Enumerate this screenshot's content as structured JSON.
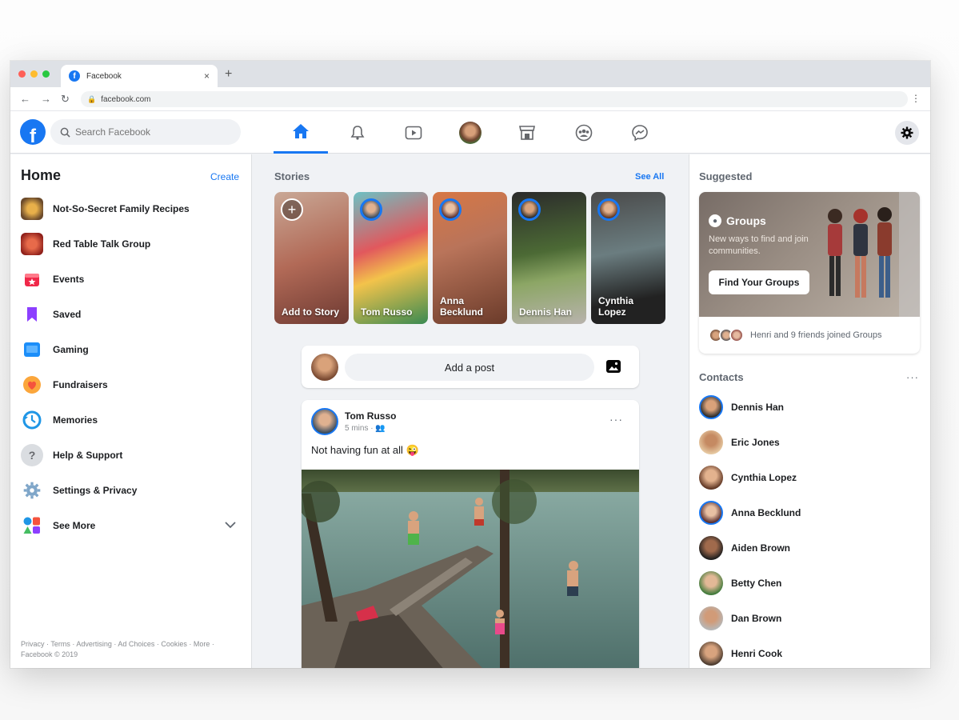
{
  "browser": {
    "tab_title": "Facebook",
    "tab_close": "×",
    "new_tab": "+",
    "url": "facebook.com",
    "back": "←",
    "forward": "→",
    "reload": "↻",
    "menu": "⋮"
  },
  "header": {
    "logo": "f",
    "search_placeholder": "Search Facebook",
    "nav_icons": [
      "home-icon",
      "bell-icon",
      "watch-icon",
      "profile-avatar",
      "marketplace-icon",
      "groups-icon",
      "messenger-icon"
    ],
    "active_tab": "home",
    "brand_color": "#1877f2"
  },
  "left": {
    "title": "Home",
    "create_label": "Create",
    "items": [
      {
        "label": "Not-So-Secret Family Recipes",
        "icon": "recipes-group-icon",
        "color": "#b8742e"
      },
      {
        "label": "Red Table Talk Group",
        "icon": "red-table-group-icon",
        "color": "#c0392b"
      },
      {
        "label": "Events",
        "icon": "events-icon",
        "color": "#f02849"
      },
      {
        "label": "Saved",
        "icon": "saved-icon",
        "color": "#8c3fff"
      },
      {
        "label": "Gaming",
        "icon": "gaming-icon",
        "color": "#1c8ef9"
      },
      {
        "label": "Fundraisers",
        "icon": "fundraisers-icon",
        "color": "#f5533d"
      },
      {
        "label": "Memories",
        "icon": "memories-icon",
        "color": "#1f96e6"
      },
      {
        "label": "Help & Support",
        "icon": "help-icon",
        "color": "#b0b3b8"
      },
      {
        "label": "Settings & Privacy",
        "icon": "settings-icon",
        "color": "#7fa6c9"
      },
      {
        "label": "See More",
        "icon": "see-more-icon",
        "color": "#e74c3c"
      }
    ],
    "footer": "Privacy · Terms · Advertising · Ad Choices · Cookies · More · Facebook © 2019"
  },
  "stories": {
    "title": "Stories",
    "see_all": "See All",
    "items": [
      {
        "name": "Add to Story"
      },
      {
        "name": "Tom Russo"
      },
      {
        "name": "Anna Becklund"
      },
      {
        "name": "Dennis Han"
      },
      {
        "name": "Cynthia Lopez"
      }
    ]
  },
  "composer": {
    "placeholder": "Add a post"
  },
  "post": {
    "author": "Tom Russo",
    "meta": "5 mins · 👥",
    "text": "Not having fun at all 😜",
    "more": "···"
  },
  "right": {
    "suggested_title": "Suggested",
    "groups_title": "Groups",
    "groups_subtitle": "New ways to find and join communities.",
    "groups_button": "Find Your Groups",
    "groups_footer": "Henri and 9 friends joined Groups",
    "contacts_title": "Contacts",
    "contacts_more": "···",
    "contacts": [
      {
        "name": "Dennis Han"
      },
      {
        "name": "Eric Jones"
      },
      {
        "name": "Cynthia Lopez"
      },
      {
        "name": "Anna Becklund"
      },
      {
        "name": "Aiden Brown"
      },
      {
        "name": "Betty Chen"
      },
      {
        "name": "Dan Brown"
      },
      {
        "name": "Henri Cook"
      }
    ]
  }
}
